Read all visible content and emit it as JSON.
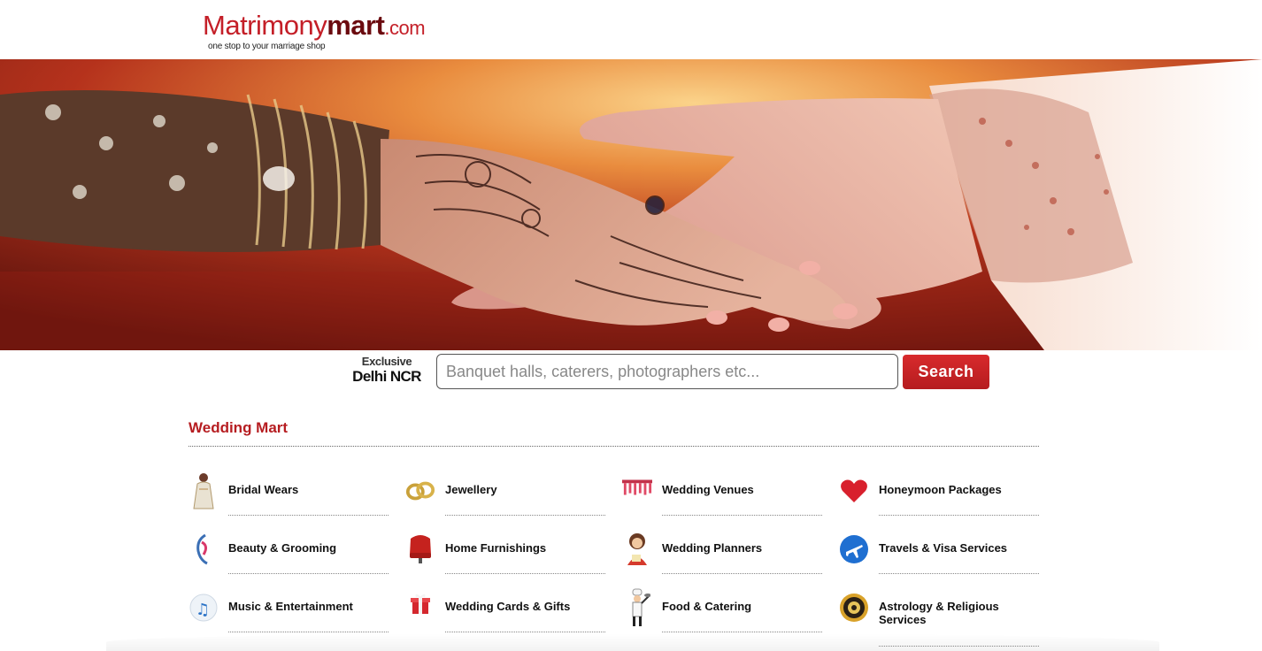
{
  "logo": {
    "brand_prefix": "Matrimony",
    "brand_suffix": "mart",
    "brand_tld": ".com",
    "tagline": "one stop to your marriage shop"
  },
  "hero": {
    "icon": "hands-with-mehndi-photo"
  },
  "search": {
    "exclusive_top": "Exclusive",
    "exclusive_bottom": "Delhi NCR",
    "placeholder": "Banquet halls, caterers, photographers etc...",
    "button_label": "Search"
  },
  "section": {
    "title": "Wedding Mart"
  },
  "categories": [
    {
      "label": "Bridal Wears",
      "icon": "bride-icon"
    },
    {
      "label": "Jewellery",
      "icon": "rings-icon"
    },
    {
      "label": "Wedding Venues",
      "icon": "venue-curtain-icon"
    },
    {
      "label": "Honeymoon Packages",
      "icon": "heart-icon"
    },
    {
      "label": "Beauty & Grooming",
      "icon": "beauty-face-icon"
    },
    {
      "label": "Home Furnishings",
      "icon": "armchair-icon"
    },
    {
      "label": "Wedding Planners",
      "icon": "planner-woman-icon"
    },
    {
      "label": "Travels & Visa Services",
      "icon": "airplane-icon"
    },
    {
      "label": "Music & Entertainment",
      "icon": "music-notes-icon"
    },
    {
      "label": "Wedding Cards & Gifts",
      "icon": "gift-box-icon"
    },
    {
      "label": "Food & Catering",
      "icon": "chef-icon"
    },
    {
      "label": "Astrology & Religious Services",
      "icon": "astrology-wheel-icon"
    }
  ],
  "colors": {
    "brand_red": "#c41f28",
    "section_red": "#b61d21",
    "button_red": "#c8232a"
  }
}
